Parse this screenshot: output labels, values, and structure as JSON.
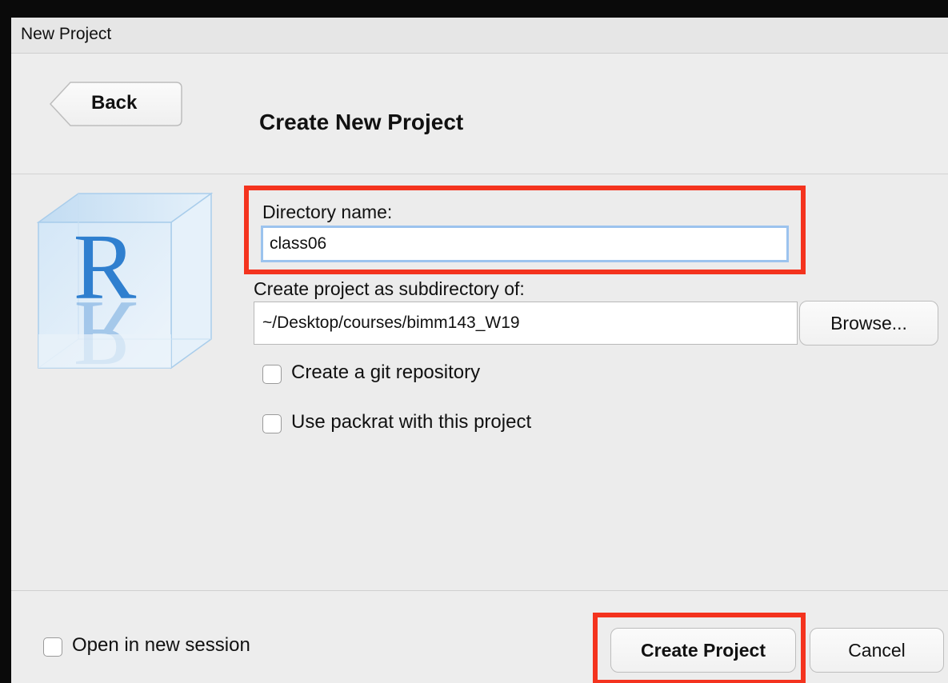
{
  "window": {
    "title": "New Project"
  },
  "header": {
    "back_label": "Back",
    "page_title": "Create New Project"
  },
  "form": {
    "directory_name_label": "Directory name:",
    "directory_name_value": "class06",
    "subdirectory_label": "Create project as subdirectory of:",
    "subdirectory_value": "~/Desktop/courses/bimm143_W19",
    "browse_label": "Browse...",
    "git_checkbox_label": "Create a git repository",
    "git_checked": false,
    "packrat_checkbox_label": "Use packrat with this project",
    "packrat_checked": false
  },
  "logo": {
    "icon": "r-logo-icon",
    "letter": "R"
  },
  "footer": {
    "new_session_label": "Open in new session",
    "new_session_checked": false,
    "create_label": "Create Project",
    "cancel_label": "Cancel"
  },
  "colors": {
    "highlight": "#f4331e",
    "focus_ring": "#9cc3ee",
    "logo_blue": "#2f7fcf"
  }
}
